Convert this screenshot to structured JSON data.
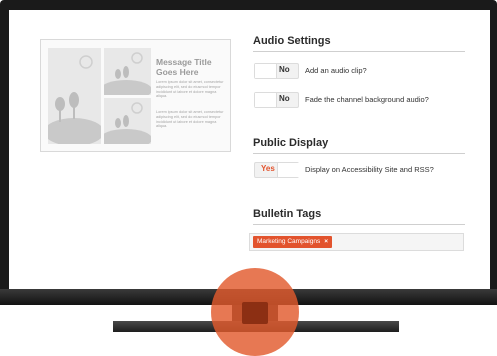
{
  "preview": {
    "title": "Message Title Goes Here",
    "body_1": "Lorem ipsum dolor sit amet, consectetur adipiscing elit, sed do eiusmod tempor incididunt ut labore et dolore magna aliqua.",
    "body_2": "Lorem ipsum dolor sit amet, consectetur adipiscing elit, sed do eiusmod tempor incididunt ut labore et dolore magna aliqua."
  },
  "audio": {
    "title": "Audio Settings",
    "items": [
      {
        "value": "No",
        "label": "Add an audio clip?"
      },
      {
        "value": "No",
        "label": "Fade the channel background audio?"
      }
    ]
  },
  "public": {
    "title": "Public Display",
    "value": "Yes",
    "label": "Display on Accessibility Site and RSS?"
  },
  "tags": {
    "title": "Bulletin Tags",
    "items": [
      {
        "label": "Marketing Campaigns",
        "remove": "×"
      }
    ]
  },
  "colors": {
    "accent": "#e2532d",
    "monitor": "#1a1a1a"
  }
}
